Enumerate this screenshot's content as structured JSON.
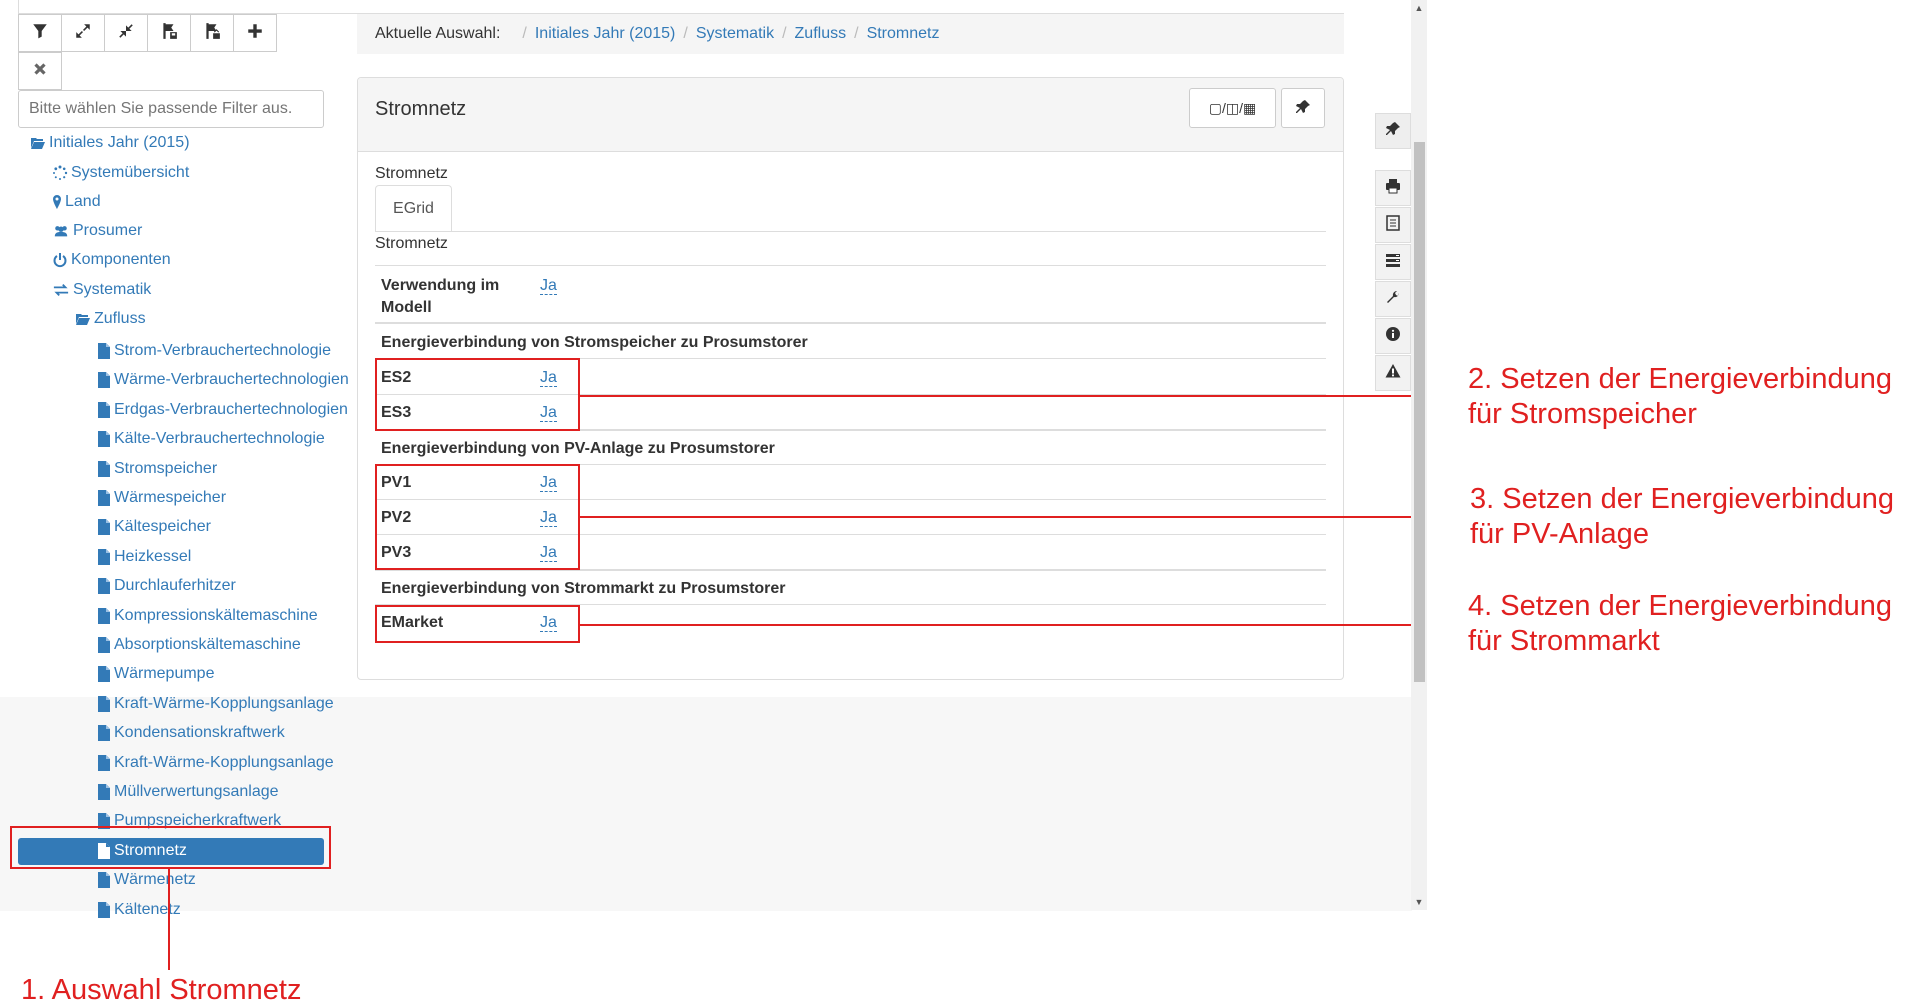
{
  "toolbar": {
    "icons": [
      "filter-icon",
      "expand-icon",
      "collapse-icon",
      "save-tree-icon",
      "save-tree-alt-icon",
      "plus-icon",
      "close-icon"
    ]
  },
  "filter": {
    "placeholder": "Bitte wählen Sie passende Filter aus."
  },
  "tree": {
    "root": "Initiales Jahr (2015)",
    "items": [
      "Systemübersicht",
      "Land",
      "Prosumer",
      "Komponenten",
      "Systematik"
    ],
    "zufluss": "Zufluss",
    "children": [
      "Strom-Verbrauchertechnologie",
      "Wärme-Verbrauchertechnologien",
      "Erdgas-Verbrauchertechnologien",
      "Kälte-Verbrauchertechnologie",
      "Stromspeicher",
      "Wärmespeicher",
      "Kältespeicher",
      "Heizkessel",
      "Durchlauferhitzer",
      "Kompressionskältemaschine",
      "Absorptionskältemaschine",
      "Wärmepumpe",
      "Kraft-Wärme-Kopplungsanlage",
      "Kondensationskraftwerk",
      "Kraft-Wärme-Kopplungsanlage",
      "Müllverwertungsanlage",
      "Pumpspeicherkraftwerk",
      "Stromnetz",
      "Wärmenetz",
      "Kältenetz"
    ],
    "selected": "Stromnetz"
  },
  "breadcrumb": {
    "label": "Aktuelle Auswahl:",
    "crumbs": [
      "Initiales Jahr (2015)",
      "Systematik",
      "Zufluss",
      "Stromnetz"
    ]
  },
  "panel": {
    "title": "Stromnetz",
    "layout_btn": "▢/◫/▦",
    "subtitle": "Stromnetz",
    "tab": "EGrid",
    "section_title": "Stromnetz",
    "usage_key": "Verwendung im Modell",
    "usage_key_l1": "Verwendung im",
    "usage_key_l2": "Modell",
    "usage_val": "Ja",
    "sec1": "Energieverbindung von Stromspeicher zu Prosumstorer",
    "sec1_rows": [
      {
        "k": "ES2",
        "v": "Ja"
      },
      {
        "k": "ES3",
        "v": "Ja"
      }
    ],
    "sec2": "Energieverbindung von PV-Anlage zu Prosumstorer",
    "sec2_rows": [
      {
        "k": "PV1",
        "v": "Ja"
      },
      {
        "k": "PV2",
        "v": "Ja"
      },
      {
        "k": "PV3",
        "v": "Ja"
      }
    ],
    "sec3": "Energieverbindung von Strommarkt zu Prosumstorer",
    "sec3_rows": [
      {
        "k": "EMarket",
        "v": "Ja"
      }
    ]
  },
  "annotations": {
    "a1": "1. Auswahl Stromnetz",
    "a2_l1": "2. Setzen der Energieverbindung",
    "a2_l2": "für Stromspeicher",
    "a3_l1": "3. Setzen der Energieverbindung",
    "a3_l2": "für PV-Anlage",
    "a4_l1": "4. Setzen der Energieverbindung",
    "a4_l2": "für Strommarkt"
  },
  "colors": {
    "link": "#337ab7",
    "annotation": "#e02020",
    "selected_bg": "#337ab7"
  }
}
